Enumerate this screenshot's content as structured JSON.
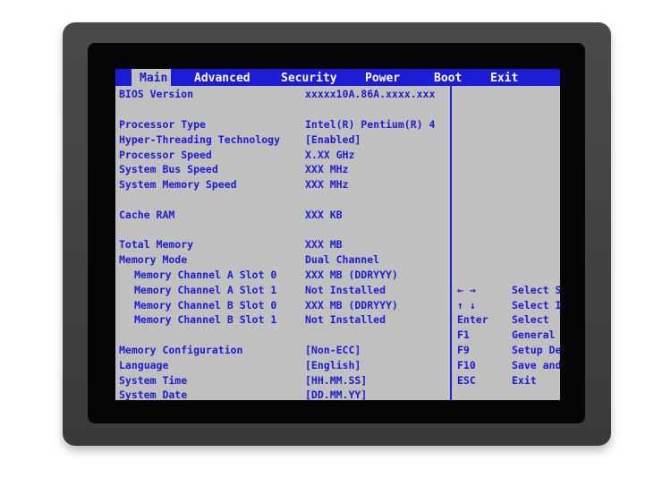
{
  "menu": {
    "tabs": [
      {
        "label": "Main"
      },
      {
        "label": "Advanced"
      },
      {
        "label": "Security"
      },
      {
        "label": "Power"
      },
      {
        "label": "Boot"
      },
      {
        "label": "Exit"
      }
    ],
    "active": "Main"
  },
  "main": {
    "rows": [
      {
        "label": "BIOS Version",
        "value": "xxxxx10A.86A.xxxx.xxx"
      },
      {
        "label": "Processor Type",
        "value": "Intel(R) Pentium(R) 4"
      },
      {
        "label": "Hyper-Threading Technology",
        "value": "[Enabled]"
      },
      {
        "label": "Processor Speed",
        "value": "X.XX GHz"
      },
      {
        "label": "System Bus Speed",
        "value": "XXX MHz"
      },
      {
        "label": "System Memory Speed",
        "value": "XXX MHz"
      },
      {
        "label": "Cache RAM",
        "value": "XXX KB"
      },
      {
        "label": "Total Memory",
        "value": "XXX MB"
      },
      {
        "label": "Memory Mode",
        "value": "Dual Channel"
      },
      {
        "label": "Memory Channel A Slot 0",
        "value": "XXX MB (DDRYYY)"
      },
      {
        "label": "Memory Channel A Slot 1",
        "value": "Not Installed"
      },
      {
        "label": "Memory Channel B Slot 0",
        "value": "XXX MB (DDRYYY)"
      },
      {
        "label": "Memory Channel B Slot 1",
        "value": "Not Installed"
      },
      {
        "label": "Memory Configuration",
        "value": "[Non-ECC]"
      },
      {
        "label": "Language",
        "value": "[English]"
      },
      {
        "label": "System Time",
        "value": "[HH.MM.SS]"
      },
      {
        "label": "System Date",
        "value": "[DD.MM.YY]"
      }
    ]
  },
  "help": {
    "rows": [
      {
        "key": "← →",
        "desc": "Select S"
      },
      {
        "key": "↑ ↓",
        "desc": "Select I"
      },
      {
        "key": "Enter",
        "desc": "Select"
      },
      {
        "key": "F1",
        "desc": "General"
      },
      {
        "key": "F9",
        "desc": "Setup De"
      },
      {
        "key": "F10",
        "desc": "Save and"
      },
      {
        "key": "ESC",
        "desc": "Exit"
      }
    ]
  },
  "colors": {
    "bios_blue": "#1c1cd6",
    "bios_gray": "#c0c0c0",
    "bezel": "#050505",
    "monitor_frame": "#424242"
  }
}
